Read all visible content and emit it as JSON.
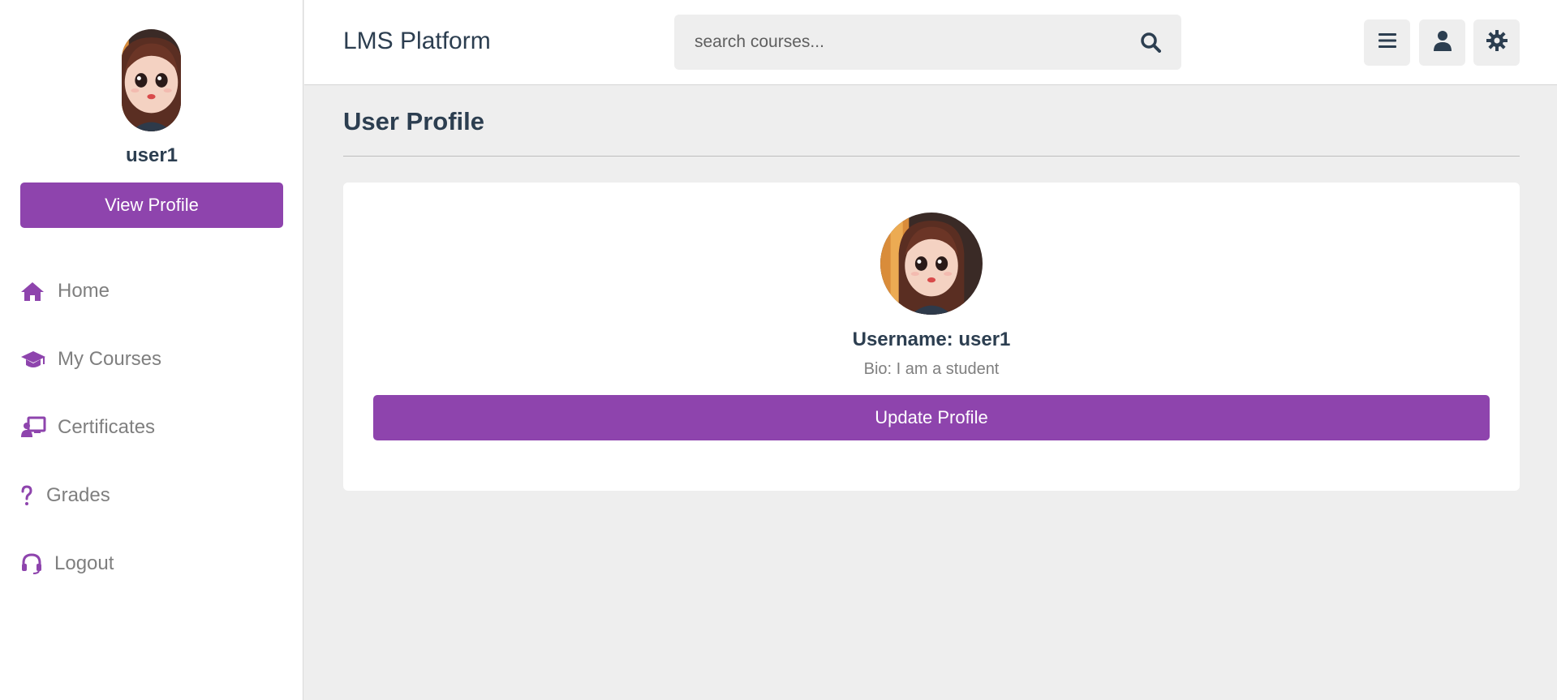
{
  "app": {
    "brand": "LMS Platform"
  },
  "search": {
    "placeholder": "search courses...",
    "value": ""
  },
  "sidebar": {
    "username": "user1",
    "view_profile_label": "View Profile",
    "items": [
      {
        "label": "Home",
        "icon": "home-icon"
      },
      {
        "label": "My Courses",
        "icon": "graduation-cap-icon"
      },
      {
        "label": "Certificates",
        "icon": "certificate-icon"
      },
      {
        "label": "Grades",
        "icon": "question-icon"
      },
      {
        "label": "Logout",
        "icon": "headset-icon"
      }
    ]
  },
  "header": {
    "buttons": [
      {
        "icon": "menu-icon"
      },
      {
        "icon": "user-icon"
      },
      {
        "icon": "settings-icon"
      }
    ]
  },
  "main": {
    "title": "User Profile",
    "profile": {
      "username_line": "Username: user1",
      "bio_line": "Bio: I am a student",
      "update_label": "Update Profile"
    }
  },
  "colors": {
    "accent": "#8e44ad",
    "text_dark": "#2c3e50",
    "text_muted": "#7f7f7f",
    "background": "#eeeeee"
  }
}
